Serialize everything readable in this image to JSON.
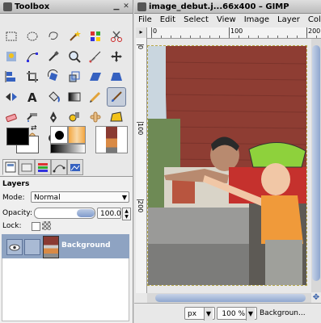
{
  "toolbox": {
    "title": "Toolbox",
    "tools": [
      "rect-select-icon",
      "ellipse-select-icon",
      "lasso-icon",
      "fuzzy-select-icon",
      "select-by-color-icon",
      "scissors-icon",
      "foreground-select-icon",
      "paths-icon",
      "color-picker-icon",
      "zoom-icon",
      "measure-icon",
      "move-icon",
      "align-icon",
      "crop-icon",
      "rotate-icon",
      "scale-icon",
      "shear-icon",
      "perspective-icon",
      "flip-icon",
      "text-icon",
      "bucket-fill-icon",
      "blend-icon",
      "pencil-icon",
      "paintbrush-icon",
      "eraser-icon",
      "airbrush-icon",
      "ink-icon",
      "clone-icon",
      "heal-icon",
      "perspective-clone-icon",
      "blur-icon",
      "smudge-icon",
      "dodge-burn-icon"
    ],
    "active_tool_index": 23
  },
  "colors": {
    "foreground": "#000000",
    "background": "#ffffff"
  },
  "layers": {
    "title": "Layers",
    "mode_label": "Mode:",
    "mode_value": "Normal",
    "opacity_label": "Opacity:",
    "opacity_value": "100.0",
    "lock_label": "Lock:",
    "layer_name": "Background"
  },
  "image_window": {
    "title": "image_debut.j...66x400 – GIMP",
    "menus": [
      "File",
      "Edit",
      "Select",
      "View",
      "Image",
      "Layer",
      "Colo"
    ],
    "ruler_marks": [
      "0",
      "100",
      "200"
    ],
    "vruler_marks": [
      "0",
      "100",
      "200"
    ],
    "unit": "px",
    "zoom": "100 %",
    "status": "Backgroun..."
  }
}
